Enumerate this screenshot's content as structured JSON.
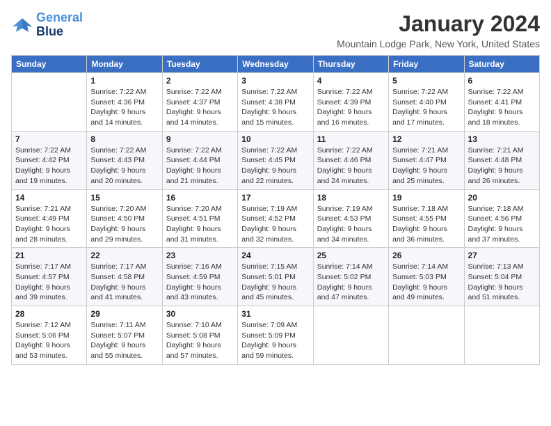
{
  "header": {
    "logo_line1": "General",
    "logo_line2": "Blue",
    "title": "January 2024",
    "location": "Mountain Lodge Park, New York, United States"
  },
  "days_of_week": [
    "Sunday",
    "Monday",
    "Tuesday",
    "Wednesday",
    "Thursday",
    "Friday",
    "Saturday"
  ],
  "weeks": [
    [
      {
        "day": "",
        "sunrise": "",
        "sunset": "",
        "daylight": ""
      },
      {
        "day": "1",
        "sunrise": "Sunrise: 7:22 AM",
        "sunset": "Sunset: 4:36 PM",
        "daylight": "Daylight: 9 hours and 14 minutes."
      },
      {
        "day": "2",
        "sunrise": "Sunrise: 7:22 AM",
        "sunset": "Sunset: 4:37 PM",
        "daylight": "Daylight: 9 hours and 14 minutes."
      },
      {
        "day": "3",
        "sunrise": "Sunrise: 7:22 AM",
        "sunset": "Sunset: 4:38 PM",
        "daylight": "Daylight: 9 hours and 15 minutes."
      },
      {
        "day": "4",
        "sunrise": "Sunrise: 7:22 AM",
        "sunset": "Sunset: 4:39 PM",
        "daylight": "Daylight: 9 hours and 16 minutes."
      },
      {
        "day": "5",
        "sunrise": "Sunrise: 7:22 AM",
        "sunset": "Sunset: 4:40 PM",
        "daylight": "Daylight: 9 hours and 17 minutes."
      },
      {
        "day": "6",
        "sunrise": "Sunrise: 7:22 AM",
        "sunset": "Sunset: 4:41 PM",
        "daylight": "Daylight: 9 hours and 18 minutes."
      }
    ],
    [
      {
        "day": "7",
        "sunrise": "Sunrise: 7:22 AM",
        "sunset": "Sunset: 4:42 PM",
        "daylight": "Daylight: 9 hours and 19 minutes."
      },
      {
        "day": "8",
        "sunrise": "Sunrise: 7:22 AM",
        "sunset": "Sunset: 4:43 PM",
        "daylight": "Daylight: 9 hours and 20 minutes."
      },
      {
        "day": "9",
        "sunrise": "Sunrise: 7:22 AM",
        "sunset": "Sunset: 4:44 PM",
        "daylight": "Daylight: 9 hours and 21 minutes."
      },
      {
        "day": "10",
        "sunrise": "Sunrise: 7:22 AM",
        "sunset": "Sunset: 4:45 PM",
        "daylight": "Daylight: 9 hours and 22 minutes."
      },
      {
        "day": "11",
        "sunrise": "Sunrise: 7:22 AM",
        "sunset": "Sunset: 4:46 PM",
        "daylight": "Daylight: 9 hours and 24 minutes."
      },
      {
        "day": "12",
        "sunrise": "Sunrise: 7:21 AM",
        "sunset": "Sunset: 4:47 PM",
        "daylight": "Daylight: 9 hours and 25 minutes."
      },
      {
        "day": "13",
        "sunrise": "Sunrise: 7:21 AM",
        "sunset": "Sunset: 4:48 PM",
        "daylight": "Daylight: 9 hours and 26 minutes."
      }
    ],
    [
      {
        "day": "14",
        "sunrise": "Sunrise: 7:21 AM",
        "sunset": "Sunset: 4:49 PM",
        "daylight": "Daylight: 9 hours and 28 minutes."
      },
      {
        "day": "15",
        "sunrise": "Sunrise: 7:20 AM",
        "sunset": "Sunset: 4:50 PM",
        "daylight": "Daylight: 9 hours and 29 minutes."
      },
      {
        "day": "16",
        "sunrise": "Sunrise: 7:20 AM",
        "sunset": "Sunset: 4:51 PM",
        "daylight": "Daylight: 9 hours and 31 minutes."
      },
      {
        "day": "17",
        "sunrise": "Sunrise: 7:19 AM",
        "sunset": "Sunset: 4:52 PM",
        "daylight": "Daylight: 9 hours and 32 minutes."
      },
      {
        "day": "18",
        "sunrise": "Sunrise: 7:19 AM",
        "sunset": "Sunset: 4:53 PM",
        "daylight": "Daylight: 9 hours and 34 minutes."
      },
      {
        "day": "19",
        "sunrise": "Sunrise: 7:18 AM",
        "sunset": "Sunset: 4:55 PM",
        "daylight": "Daylight: 9 hours and 36 minutes."
      },
      {
        "day": "20",
        "sunrise": "Sunrise: 7:18 AM",
        "sunset": "Sunset: 4:56 PM",
        "daylight": "Daylight: 9 hours and 37 minutes."
      }
    ],
    [
      {
        "day": "21",
        "sunrise": "Sunrise: 7:17 AM",
        "sunset": "Sunset: 4:57 PM",
        "daylight": "Daylight: 9 hours and 39 minutes."
      },
      {
        "day": "22",
        "sunrise": "Sunrise: 7:17 AM",
        "sunset": "Sunset: 4:58 PM",
        "daylight": "Daylight: 9 hours and 41 minutes."
      },
      {
        "day": "23",
        "sunrise": "Sunrise: 7:16 AM",
        "sunset": "Sunset: 4:59 PM",
        "daylight": "Daylight: 9 hours and 43 minutes."
      },
      {
        "day": "24",
        "sunrise": "Sunrise: 7:15 AM",
        "sunset": "Sunset: 5:01 PM",
        "daylight": "Daylight: 9 hours and 45 minutes."
      },
      {
        "day": "25",
        "sunrise": "Sunrise: 7:14 AM",
        "sunset": "Sunset: 5:02 PM",
        "daylight": "Daylight: 9 hours and 47 minutes."
      },
      {
        "day": "26",
        "sunrise": "Sunrise: 7:14 AM",
        "sunset": "Sunset: 5:03 PM",
        "daylight": "Daylight: 9 hours and 49 minutes."
      },
      {
        "day": "27",
        "sunrise": "Sunrise: 7:13 AM",
        "sunset": "Sunset: 5:04 PM",
        "daylight": "Daylight: 9 hours and 51 minutes."
      }
    ],
    [
      {
        "day": "28",
        "sunrise": "Sunrise: 7:12 AM",
        "sunset": "Sunset: 5:06 PM",
        "daylight": "Daylight: 9 hours and 53 minutes."
      },
      {
        "day": "29",
        "sunrise": "Sunrise: 7:11 AM",
        "sunset": "Sunset: 5:07 PM",
        "daylight": "Daylight: 9 hours and 55 minutes."
      },
      {
        "day": "30",
        "sunrise": "Sunrise: 7:10 AM",
        "sunset": "Sunset: 5:08 PM",
        "daylight": "Daylight: 9 hours and 57 minutes."
      },
      {
        "day": "31",
        "sunrise": "Sunrise: 7:09 AM",
        "sunset": "Sunset: 5:09 PM",
        "daylight": "Daylight: 9 hours and 59 minutes."
      },
      {
        "day": "",
        "sunrise": "",
        "sunset": "",
        "daylight": ""
      },
      {
        "day": "",
        "sunrise": "",
        "sunset": "",
        "daylight": ""
      },
      {
        "day": "",
        "sunrise": "",
        "sunset": "",
        "daylight": ""
      }
    ]
  ]
}
